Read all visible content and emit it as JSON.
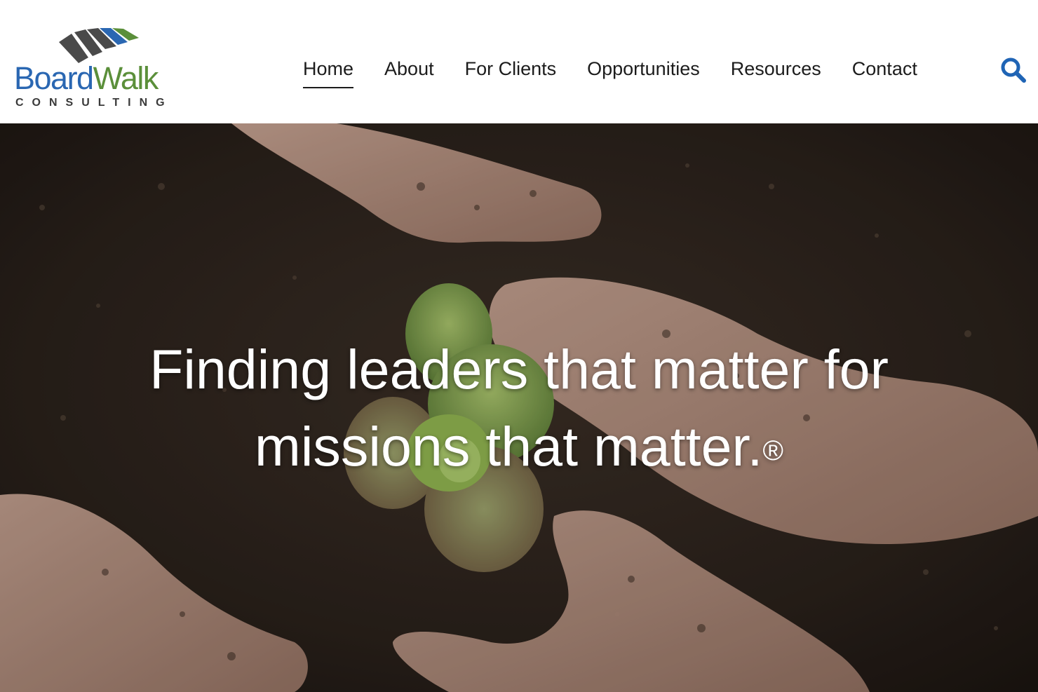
{
  "brand": {
    "name_part1": "Board",
    "name_part2": "Walk",
    "tagline": "CONSULTING",
    "colors": {
      "blue": "#2a67b2",
      "green": "#5b8f3a",
      "gray": "#4a4a4a"
    }
  },
  "nav": {
    "items": [
      {
        "label": "Home",
        "active": true
      },
      {
        "label": "About",
        "active": false
      },
      {
        "label": "For Clients",
        "active": false
      },
      {
        "label": "Opportunities",
        "active": false
      },
      {
        "label": "Resources",
        "active": false
      },
      {
        "label": "Contact",
        "active": false
      }
    ],
    "search_icon": "search-icon",
    "search_color": "#1f64b5"
  },
  "hero": {
    "line1": "Finding leaders that matter for",
    "line2": "missions that matter.",
    "mark": "®"
  }
}
